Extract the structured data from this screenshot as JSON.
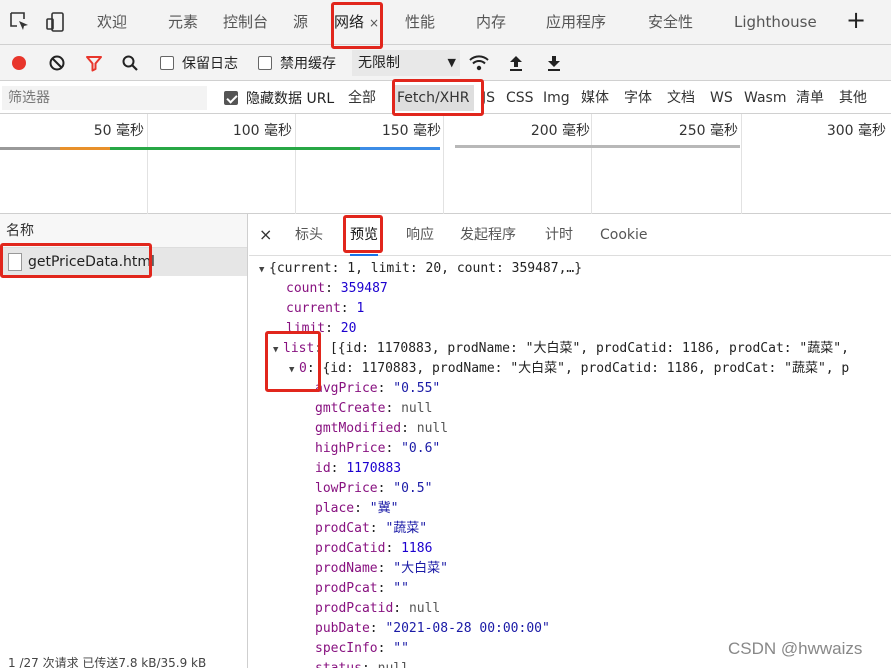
{
  "tabs": [
    {
      "label": "欢迎"
    },
    {
      "label": "元素"
    },
    {
      "label": "控制台"
    },
    {
      "label": "源"
    },
    {
      "label": "网络"
    },
    {
      "label": "性能"
    },
    {
      "label": "内存"
    },
    {
      "label": "应用程序"
    },
    {
      "label": "安全性"
    },
    {
      "label": "Lighthouse"
    }
  ],
  "tab_close_glyph": "×",
  "add_tab_glyph": "+",
  "toolbar": {
    "preserve_log": "保留日志",
    "disable_cache": "禁用缓存",
    "throttle": "无限制"
  },
  "filter": {
    "placeholder": "筛选器",
    "hide_data_urls": "隐藏数据 URL",
    "types": [
      "全部",
      "Fetch/XHR",
      "JS",
      "CSS",
      "Img",
      "媒体",
      "字体",
      "文档",
      "WS",
      "Wasm",
      "清单",
      "其他"
    ]
  },
  "timeline": {
    "ticks": [
      "50 毫秒",
      "100 毫秒",
      "150 毫秒",
      "200 毫秒",
      "250 毫秒",
      "300 毫秒"
    ]
  },
  "requests": {
    "header": "名称",
    "rows": [
      {
        "name": "getPriceData.html"
      }
    ],
    "status": "1 /27 次请求  已传送7.8 kB/35.9 kB"
  },
  "detail": {
    "close_glyph": "×",
    "tabs": [
      "标头",
      "预览",
      "响应",
      "发起程序",
      "计时",
      "Cookie"
    ]
  },
  "preview": {
    "root_summary": "{current: 1, limit: 20, count: 359487,…}",
    "count_key": "count",
    "count_val": "359487",
    "current_key": "current",
    "current_val": "1",
    "limit_key": "limit",
    "limit_val": "20",
    "list_key": "list",
    "list_summary": "[{id: 1170883, prodName: \"大白菜\", prodCatid: 1186, prodCat: \"蔬菜\",",
    "item0_key": "0",
    "item0_summary": "{id: 1170883, prodName: \"大白菜\", prodCatid: 1186, prodCat: \"蔬菜\", p",
    "fields": [
      {
        "key": "avgPrice",
        "val": "\"0.55\"",
        "type": "s"
      },
      {
        "key": "gmtCreate",
        "val": "null",
        "type": "nul"
      },
      {
        "key": "gmtModified",
        "val": "null",
        "type": "nul"
      },
      {
        "key": "highPrice",
        "val": "\"0.6\"",
        "type": "s"
      },
      {
        "key": "id",
        "val": "1170883",
        "type": "n"
      },
      {
        "key": "lowPrice",
        "val": "\"0.5\"",
        "type": "s"
      },
      {
        "key": "place",
        "val": "\"冀\"",
        "type": "s"
      },
      {
        "key": "prodCat",
        "val": "\"蔬菜\"",
        "type": "s"
      },
      {
        "key": "prodCatid",
        "val": "1186",
        "type": "n"
      },
      {
        "key": "prodName",
        "val": "\"大白菜\"",
        "type": "s"
      },
      {
        "key": "prodPcat",
        "val": "\"\"",
        "type": "s"
      },
      {
        "key": "prodPcatid",
        "val": "null",
        "type": "nul"
      },
      {
        "key": "pubDate",
        "val": "\"2021-08-28 00:00:00\"",
        "type": "s"
      },
      {
        "key": "specInfo",
        "val": "\"\"",
        "type": "s"
      },
      {
        "key": "status",
        "val": "null",
        "type": "nul"
      }
    ]
  },
  "watermark": "CSDN @hwwaizs",
  "colors": {
    "record_red": "#e8352b",
    "filter_red": "#e8352b",
    "highlight": "#e1261c",
    "accent_blue": "#1a73e8"
  }
}
